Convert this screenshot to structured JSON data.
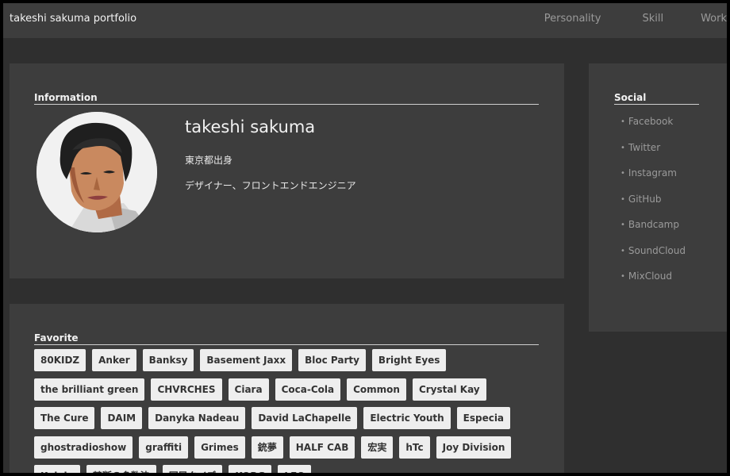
{
  "header": {
    "brand": "takeshi sakuma portfolio",
    "nav": [
      "Personality",
      "Skill",
      "Work"
    ]
  },
  "information": {
    "heading": "Information",
    "name": "takeshi sakuma",
    "origin": "東京都出身",
    "role": "デザイナー、フロントエンドエンジニア"
  },
  "social": {
    "heading": "Social",
    "items": [
      "Facebook",
      "Twitter",
      "Instagram",
      "GitHub",
      "Bandcamp",
      "SoundCloud",
      "MixCloud"
    ]
  },
  "favorite": {
    "heading": "Favorite",
    "tags": [
      "80KIDZ",
      "Anker",
      "Banksy",
      "Basement Jaxx",
      "Bloc Party",
      "Bright Eyes",
      "the brilliant green",
      "CHVRCHES",
      "Ciara",
      "Coca-Cola",
      "Common",
      "Crystal Kay",
      "The Cure",
      "DAIM",
      "Danyka Nadeau",
      "David LaChapelle",
      "Electric Youth",
      "Especia",
      "ghostradioshow",
      "graffiti",
      "Grimes",
      "銃夢",
      "HALF CAB",
      "宏実",
      "hTc",
      "Joy Division",
      "Kelela",
      "禁断の多数決",
      "国民クイズ",
      "KORG",
      "LFO"
    ]
  },
  "colors": {
    "page_bg": "#2f2f2f",
    "card_bg": "#3d3d3d",
    "muted_text": "#9a9a9a",
    "tag_bg": "#eeeeee"
  }
}
